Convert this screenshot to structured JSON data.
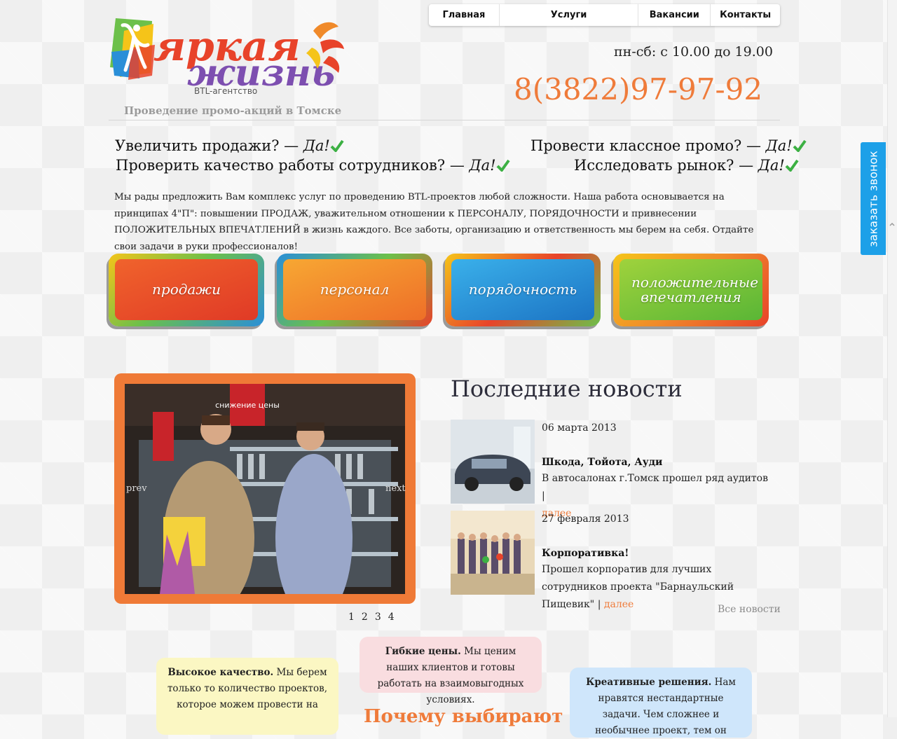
{
  "nav": {
    "items": [
      "Главная",
      "Услуги",
      "Вакансии",
      "Контакты"
    ]
  },
  "logo": {
    "line1": "яркая",
    "line2": "жизнь",
    "sub": "BTL-агентство"
  },
  "header": {
    "tagline": "Проведение промо-акций в Томске",
    "hours": "пн-сб: с 10.00 до 19.00",
    "phone": "8(3822)97-97-92"
  },
  "questions": {
    "left": [
      {
        "text": "Увеличить продажи? — ",
        "answer": "Да!"
      },
      {
        "text": "Проверить качество работы сотрудников? — ",
        "answer": "Да!"
      }
    ],
    "right": [
      {
        "text": "Провести классное промо? — ",
        "answer": "Да!"
      },
      {
        "text": "Исследовать рынок? — ",
        "answer": "Да!"
      }
    ]
  },
  "intro": "Мы рады предложить Вам комплекс услуг по проведению BTL-проектов любой сложности. Наша работа основывается на принципах 4\"П\": повышении ПРОДАЖ, уважительном отношении к ПЕРСОНАЛУ, ПОРЯДОЧНОСТИ и привнесении ПОЛОЖИТЕЛЬНЫХ ВПЕЧАТЛЕНИЙ в жизнь каждого. Все заботы, организацию и ответственность мы берем на себя. Отдайте свои задачи в руки профессионалов!",
  "tiles": [
    {
      "label": "продажи",
      "color": "#e8432a"
    },
    {
      "label": "персонал",
      "color": "#f08a2a"
    },
    {
      "label": "порядочность",
      "color": "#2a8fd8"
    },
    {
      "label": "положительные впечатления",
      "color": "#8ac43a"
    }
  ],
  "slider": {
    "prev": "prev",
    "next": "next",
    "sign1": "снижение цены",
    "pages": [
      "1",
      "2",
      "3",
      "4"
    ]
  },
  "news": {
    "heading": "Последние новости",
    "items": [
      {
        "date": "06 марта 2013",
        "title": "Шкода, Тойота, Ауди",
        "text": "В автосалонах г.Томск прошел ряд аудитов |",
        "more": "далее"
      },
      {
        "date": "27 февраля 2013",
        "title": "Корпоративка!",
        "text": "Прошел корпоратив для лучших сотрудников проекта \"Барнаульский Пищевик\" |",
        "more": "далее"
      }
    ],
    "all": "Все новости"
  },
  "features": [
    {
      "title": "Высокое качество.",
      "text": "Мы берем только то количество проектов, которое можем провести на",
      "color": "#fbf7c3"
    },
    {
      "title": "Гибкие цены.",
      "text": "Мы ценим наших клиентов и готовы работать на взаимовыгодных условиях.",
      "color": "#f9dde0"
    },
    {
      "title": "Креативные решения.",
      "text": "Нам нравятся нестандартные задачи. Чем сложнее и необычнее проект, тем он",
      "color": "#cfe6fb"
    }
  ],
  "why_heading": "Почему выбирают",
  "callback": "заказать звонок",
  "colors": {
    "accent": "#ef7b3a",
    "callback": "#1da0e8",
    "check": "#3cb043"
  }
}
